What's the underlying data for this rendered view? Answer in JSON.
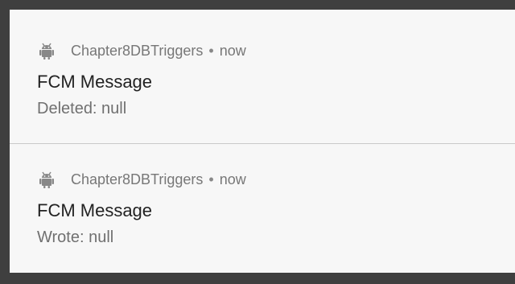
{
  "notifications": [
    {
      "app_name": "Chapter8DBTriggers",
      "separator": "•",
      "time": "now",
      "title": "FCM Message",
      "body": "Deleted: null",
      "icon": "android-icon"
    },
    {
      "app_name": "Chapter8DBTriggers",
      "separator": "•",
      "time": "now",
      "title": "FCM Message",
      "body": "Wrote: null",
      "icon": "android-icon"
    }
  ],
  "colors": {
    "shade_background": "#3f3f3f",
    "card_background": "#f7f7f7",
    "divider": "#c9c9c9",
    "app_text": "#777777",
    "title_text": "#222222",
    "body_text": "#707070"
  }
}
